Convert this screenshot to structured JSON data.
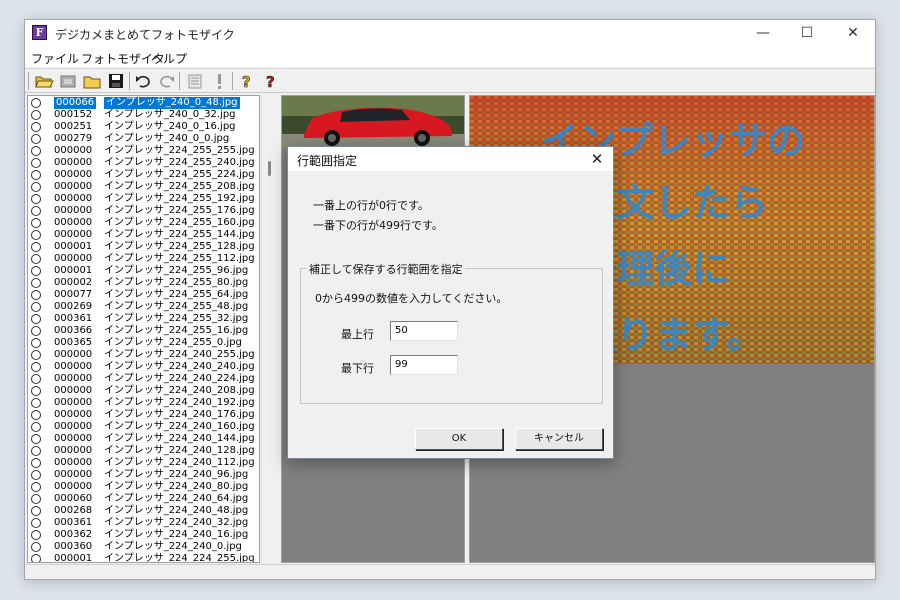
{
  "window": {
    "title": "デジカメまとめてフォトモザイク",
    "app_icon_letter": "F",
    "caption": {
      "minimize": "—",
      "maximize": "☐",
      "close": "✕"
    }
  },
  "menu": [
    "ファイル",
    "フォトモザイク",
    "ヘルプ"
  ],
  "toolbar": [
    "open-folder-icon",
    "film-icon",
    "folder-icon",
    "save-icon",
    "undo-icon",
    "redo-icon",
    "list-icon",
    "exclamation-icon",
    "help-icon",
    "help-red-icon"
  ],
  "file_list": [
    {
      "num": "000066",
      "name": "インプレッサ_240_0_48.jpg",
      "selected": true
    },
    {
      "num": "000152",
      "name": "インプレッサ_240_0_32.jpg"
    },
    {
      "num": "000251",
      "name": "インプレッサ_240_0_16.jpg"
    },
    {
      "num": "000279",
      "name": "インプレッサ_240_0_0.jpg"
    },
    {
      "num": "000000",
      "name": "インプレッサ_224_255_255.jpg"
    },
    {
      "num": "000000",
      "name": "インプレッサ_224_255_240.jpg"
    },
    {
      "num": "000000",
      "name": "インプレッサ_224_255_224.jpg"
    },
    {
      "num": "000000",
      "name": "インプレッサ_224_255_208.jpg"
    },
    {
      "num": "000000",
      "name": "インプレッサ_224_255_192.jpg"
    },
    {
      "num": "000000",
      "name": "インプレッサ_224_255_176.jpg"
    },
    {
      "num": "000000",
      "name": "インプレッサ_224_255_160.jpg"
    },
    {
      "num": "000000",
      "name": "インプレッサ_224_255_144.jpg"
    },
    {
      "num": "000001",
      "name": "インプレッサ_224_255_128.jpg"
    },
    {
      "num": "000000",
      "name": "インプレッサ_224_255_112.jpg"
    },
    {
      "num": "000001",
      "name": "インプレッサ_224_255_96.jpg"
    },
    {
      "num": "000002",
      "name": "インプレッサ_224_255_80.jpg"
    },
    {
      "num": "000077",
      "name": "インプレッサ_224_255_64.jpg"
    },
    {
      "num": "000269",
      "name": "インプレッサ_224_255_48.jpg"
    },
    {
      "num": "000361",
      "name": "インプレッサ_224_255_32.jpg"
    },
    {
      "num": "000366",
      "name": "インプレッサ_224_255_16.jpg"
    },
    {
      "num": "000365",
      "name": "インプレッサ_224_255_0.jpg"
    },
    {
      "num": "000000",
      "name": "インプレッサ_224_240_255.jpg"
    },
    {
      "num": "000000",
      "name": "インプレッサ_224_240_240.jpg"
    },
    {
      "num": "000000",
      "name": "インプレッサ_224_240_224.jpg"
    },
    {
      "num": "000000",
      "name": "インプレッサ_224_240_208.jpg"
    },
    {
      "num": "000000",
      "name": "インプレッサ_224_240_192.jpg"
    },
    {
      "num": "000000",
      "name": "インプレッサ_224_240_176.jpg"
    },
    {
      "num": "000000",
      "name": "インプレッサ_224_240_160.jpg"
    },
    {
      "num": "000000",
      "name": "インプレッサ_224_240_144.jpg"
    },
    {
      "num": "000000",
      "name": "インプレッサ_224_240_128.jpg"
    },
    {
      "num": "000000",
      "name": "インプレッサ_224_240_112.jpg"
    },
    {
      "num": "000000",
      "name": "インプレッサ_224_240_96.jpg"
    },
    {
      "num": "000000",
      "name": "インプレッサ_224_240_80.jpg"
    },
    {
      "num": "000060",
      "name": "インプレッサ_224_240_64.jpg"
    },
    {
      "num": "000268",
      "name": "インプレッサ_224_240_48.jpg"
    },
    {
      "num": "000361",
      "name": "インプレッサ_224_240_32.jpg"
    },
    {
      "num": "000362",
      "name": "インプレッサ_224_240_16.jpg"
    },
    {
      "num": "000360",
      "name": "インプレッサ_224_240_0.jpg"
    },
    {
      "num": "000001",
      "name": "インプレッサ_224_224_255.jpg"
    }
  ],
  "mosaic": {
    "lines": [
      "インプレッサの",
      "ご注文したら",
      "全修理後に",
      "お送ります。"
    ],
    "text_color": "#2a8ad8",
    "tile_colors": [
      "#c23a2a",
      "#c9a030",
      "#6f8a3a",
      "#b35a2a",
      "#a8a840"
    ]
  },
  "dialog": {
    "title": "行範囲指定",
    "close": "✕",
    "info_top": "一番上の行が0行です。",
    "info_bottom": "一番下の行が499行です。",
    "group_label": "補正して保存する行範囲を指定",
    "instruction": "0から499の数値を入力してください。",
    "top_label": "最上行",
    "top_value": "50",
    "bottom_label": "最下行",
    "bottom_value": "99",
    "ok": "OK",
    "cancel": "キャンセル"
  }
}
